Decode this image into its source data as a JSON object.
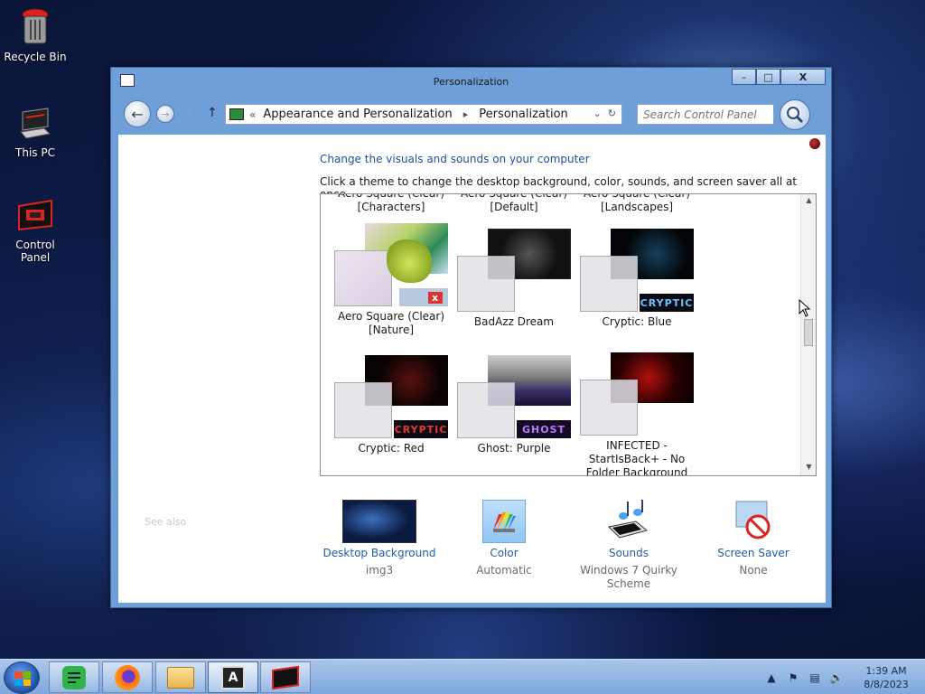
{
  "desktop": {
    "icons": [
      {
        "label": "Recycle Bin"
      },
      {
        "label": "This PC"
      },
      {
        "label": "Control Panel"
      }
    ]
  },
  "window": {
    "title": "Personalization",
    "buttons": {
      "minimize": "–",
      "maximize": "□",
      "close": "X"
    },
    "address": {
      "lead": "«",
      "crumbs": [
        "Appearance and Personalization",
        "Personalization"
      ],
      "separator": "▸"
    },
    "search": {
      "placeholder": "Search Control Panel"
    },
    "heading": "Change the visuals and sounds on your computer",
    "description": "Click a theme to change the desktop background, color, sounds, and screen saver all at once.",
    "themes": {
      "row0": [
        {
          "line1": "Aero Square (Clear)",
          "line2": "[Characters]"
        },
        {
          "line1": "Aero Square (Clear)",
          "line2": "[Default]"
        },
        {
          "line1": "Aero Square (Clear)",
          "line2": "[Landscapes]"
        }
      ],
      "row1": [
        {
          "line1": "Aero Square (Clear)",
          "line2": "[Nature]"
        },
        {
          "line1": "BadAzz Dream",
          "line2": ""
        },
        {
          "line1": "Cryptic: Blue",
          "line2": "",
          "tag": "CRYPTIC"
        }
      ],
      "row2": [
        {
          "line1": "Cryptic: Red",
          "line2": "",
          "tag": "CRYPTIC"
        },
        {
          "line1": "Ghost: Purple",
          "line2": "",
          "tag": "GHOST"
        },
        {
          "line1": "INFECTED -",
          "line2": "StartIsBack+ - No",
          "line3": "Folder Background"
        }
      ]
    },
    "see_also": "See also",
    "bottom": [
      {
        "link": "Desktop Background",
        "sub": "img3"
      },
      {
        "link": "Color",
        "sub": "Automatic"
      },
      {
        "link": "Sounds",
        "sub": "Windows 7 Quirky",
        "sub2": "Scheme"
      },
      {
        "link": "Screen Saver",
        "sub": "None"
      }
    ]
  },
  "taskbar": {
    "time": "1:39 AM",
    "date": "8/8/2023"
  }
}
